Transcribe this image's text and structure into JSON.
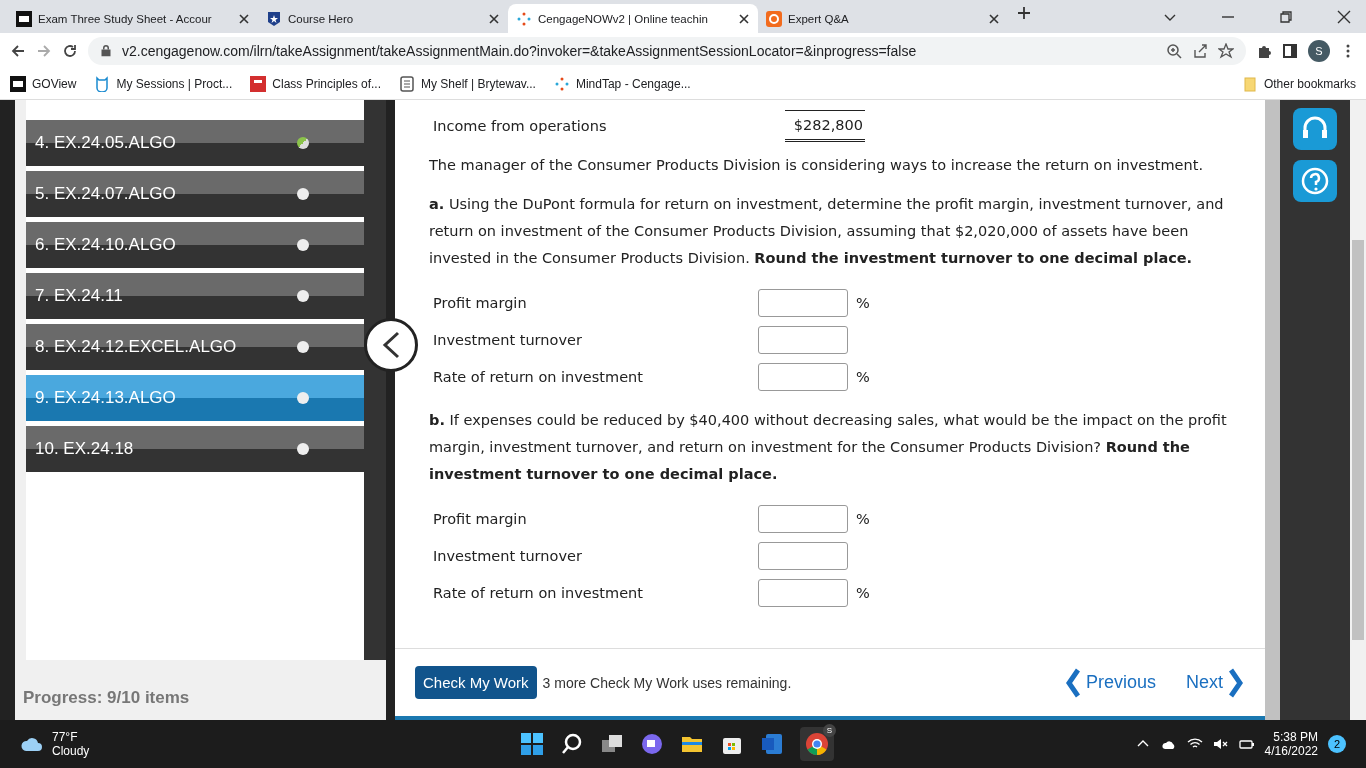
{
  "browser": {
    "tabs": [
      {
        "label": "Exam Three Study Sheet - Accour",
        "selected": false
      },
      {
        "label": "Course Hero",
        "selected": false
      },
      {
        "label": "CengageNOWv2 | Online teachin",
        "selected": true
      },
      {
        "label": "Expert Q&A",
        "selected": false
      }
    ],
    "url": "v2.cengagenow.com/ilrn/takeAssignment/takeAssignmentMain.do?invoker=&takeAssignmentSessionLocator=&inprogress=false",
    "profile": "S",
    "bookmarks": [
      {
        "label": "GOView"
      },
      {
        "label": "My Sessions | Proct..."
      },
      {
        "label": "Class Principles of..."
      },
      {
        "label": "My Shelf | Brytewav..."
      },
      {
        "label": "MindTap - Cengage..."
      }
    ],
    "other_bookmarks": "Other bookmarks"
  },
  "sidebar": {
    "items": [
      {
        "label": "4. EX.24.05.ALGO",
        "selected": false,
        "answered": true
      },
      {
        "label": "5. EX.24.07.ALGO",
        "selected": false,
        "answered": false
      },
      {
        "label": "6. EX.24.10.ALGO",
        "selected": false,
        "answered": false
      },
      {
        "label": "7. EX.24.11",
        "selected": false,
        "answered": false
      },
      {
        "label": "8. EX.24.12.EXCEL.ALGO",
        "selected": false,
        "answered": false
      },
      {
        "label": "9. EX.24.13.ALGO",
        "selected": true,
        "answered": false
      },
      {
        "label": "10. EX.24.18",
        "selected": false,
        "answered": false
      }
    ],
    "progress": "Progress:  9/10 items"
  },
  "statement": {
    "rows": [
      {
        "label": "Income from operations",
        "value": "$282,800"
      }
    ]
  },
  "intro": "The manager of the Consumer Products Division is considering ways to increase the return on investment.",
  "parts": [
    {
      "prompt": "**a.** Using the DuPont formula for return on investment, determine the profit margin, investment turnover, and return on investment of the Consumer Products Division, assuming that $2,020,000 of assets have been invested in the Consumer Products Division. **Round the investment turnover to one decimal place.**",
      "fields": [
        {
          "label": "Profit margin",
          "unit": "%"
        },
        {
          "label": "Investment turnover"
        },
        {
          "label": "Rate of return on investment",
          "unit": "%"
        }
      ]
    },
    {
      "prompt": "**b.** If expenses could be reduced by $40,400 without decreasing sales, what would be the impact on the profit margin, investment turnover, and return on investment for the Consumer Products Division? **Round the investment turnover to one decimal place.**",
      "fields": [
        {
          "label": "Profit margin",
          "unit": "%"
        },
        {
          "label": "Investment turnover"
        },
        {
          "label": "Rate of return on investment",
          "unit": "%"
        }
      ]
    }
  ],
  "footer": {
    "check_button": "Check My Work",
    "remaining": "3 more Check My Work uses remaining.",
    "previous": "Previous",
    "next": "Next"
  },
  "taskbar": {
    "temperature": "77°F",
    "weather": "Cloudy",
    "chrome_badge": "S",
    "time": "5:38 PM",
    "date": "4/16/2022",
    "notifications": "2"
  }
}
